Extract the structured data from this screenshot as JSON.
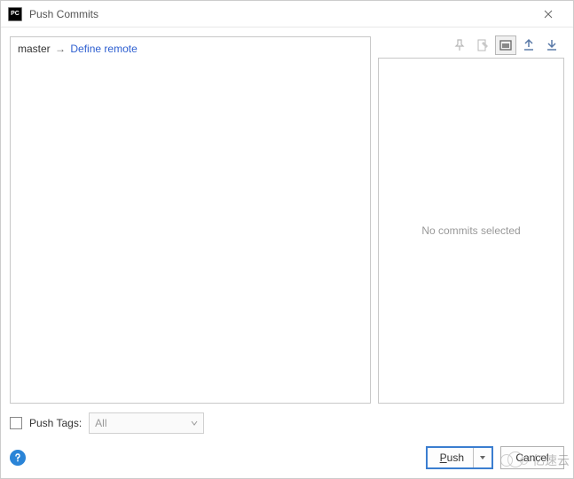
{
  "titlebar": {
    "icon_label": "PC",
    "title": "Push Commits"
  },
  "branch": {
    "local": "master",
    "arrow": "→",
    "remote_link": "Define remote"
  },
  "right_pane": {
    "placeholder": "No commits selected"
  },
  "footer": {
    "push_tags_label": "Push Tags:",
    "push_tags_value": "All"
  },
  "buttons": {
    "push_prefix": "P",
    "push_rest": "ush",
    "cancel": "Cancel"
  },
  "watermark": "亿速云",
  "icons": {
    "pin": "pin-icon",
    "edit": "edit-icon",
    "group": "group-icon",
    "expand": "expand-icon",
    "collapse": "collapse-icon"
  }
}
